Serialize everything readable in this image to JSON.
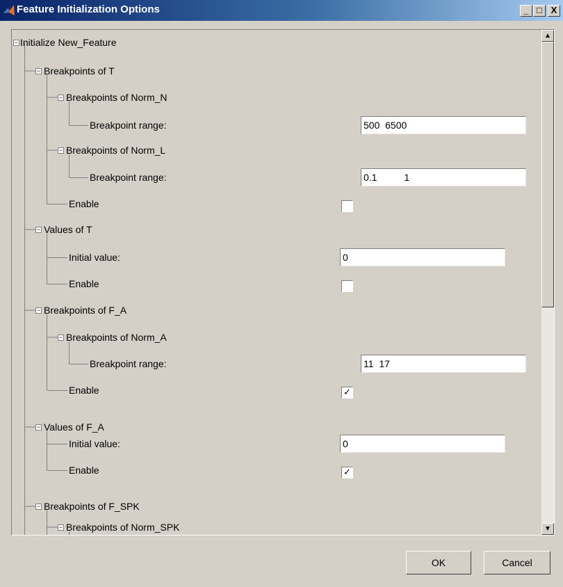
{
  "window": {
    "title": "Feature Initialization Options",
    "minimize": "_",
    "maximize": "□",
    "close": "X"
  },
  "tree": {
    "root": "Initialize New_Feature",
    "bp_T": "Breakpoints of T",
    "bp_norm_n": "Breakpoints of Norm_N",
    "bp_norm_n_range_label": "Breakpoint range:",
    "bp_norm_n_range_value": "500  6500",
    "bp_norm_l": "Breakpoints of Norm_L",
    "bp_norm_l_range_label": "Breakpoint range:",
    "bp_norm_l_range_value": "0.1          1",
    "bp_T_enable_label": "Enable",
    "bp_T_enable_checked": false,
    "val_T": "Values of T",
    "val_T_init_label": "Initial value:",
    "val_T_init_value": "0",
    "val_T_enable_label": "Enable",
    "val_T_enable_checked": false,
    "bp_FA": "Breakpoints of F_A",
    "bp_norm_a": "Breakpoints of Norm_A",
    "bp_norm_a_range_label": "Breakpoint range:",
    "bp_norm_a_range_value": "11  17",
    "bp_FA_enable_label": "Enable",
    "bp_FA_enable_checked": true,
    "val_FA": "Values of F_A",
    "val_FA_init_label": "Initial value:",
    "val_FA_init_value": "0",
    "val_FA_enable_label": "Enable",
    "val_FA_enable_checked": true,
    "bp_FSPK": "Breakpoints of F_SPK",
    "bp_norm_spk": "Breakpoints of Norm_SPK"
  },
  "buttons": {
    "ok": "OK",
    "cancel": "Cancel"
  },
  "colors": {
    "title_start": "#0a246a",
    "title_end": "#a6caf0",
    "face": "#d4d0c8"
  }
}
